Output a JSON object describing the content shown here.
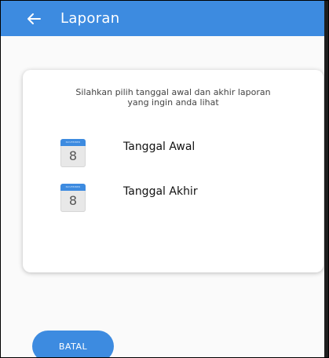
{
  "appbar": {
    "back_icon": "arrow-left-icon",
    "title": "Laporan"
  },
  "card": {
    "instruction_line1": "Silahkan pilih tanggal awal dan akhir laporan",
    "instruction_line2": "yang ingin anda lihat",
    "rows": [
      {
        "calendar_month": "NOVEMBER",
        "calendar_day": "8",
        "label": "Tanggal Awal",
        "icon": "calendar-icon"
      },
      {
        "calendar_month": "NOVEMBER",
        "calendar_day": "8",
        "label": "Tanggal Akhir",
        "icon": "calendar-icon"
      }
    ]
  },
  "footer": {
    "cancel_label": "BATAL"
  },
  "colors": {
    "primary": "#3d8be0",
    "background": "#fafafa"
  }
}
